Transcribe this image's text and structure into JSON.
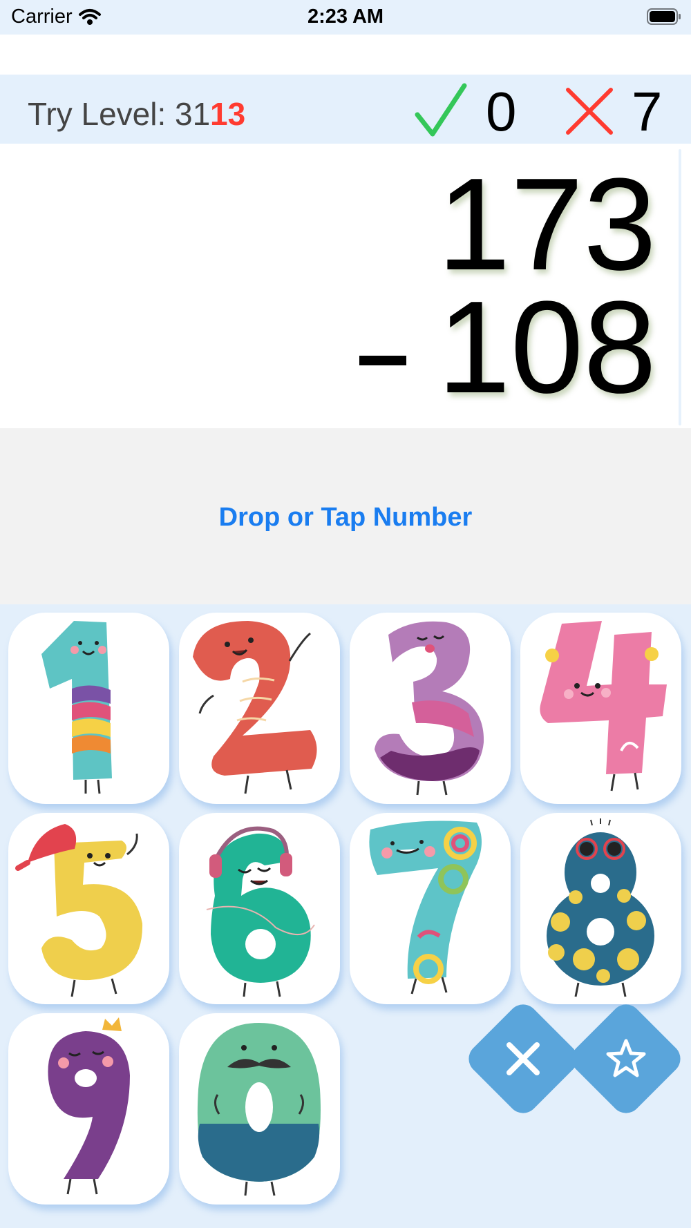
{
  "status_bar": {
    "carrier": "Carrier",
    "time": "2:23 AM"
  },
  "score": {
    "level_label": "Try Level: 31",
    "level_extra": "13",
    "correct_count": "0",
    "wrong_count": "7"
  },
  "problem": {
    "top_number": "173",
    "bottom_number": "108",
    "operator": "minus"
  },
  "drop_zone": {
    "label": "Drop or Tap Number"
  },
  "keypad": {
    "digits": [
      "1",
      "2",
      "3",
      "4",
      "5",
      "6",
      "7",
      "8",
      "9",
      "0"
    ],
    "actions": [
      {
        "name": "clear",
        "icon": "close-icon"
      },
      {
        "name": "favorite",
        "icon": "star-icon"
      }
    ]
  },
  "colors": {
    "accent_blue": "#1a7df0",
    "correct_green": "#34c759",
    "wrong_red": "#ff3b30",
    "action_button": "#5aa5db",
    "keypad_bg": "#e3effb"
  }
}
